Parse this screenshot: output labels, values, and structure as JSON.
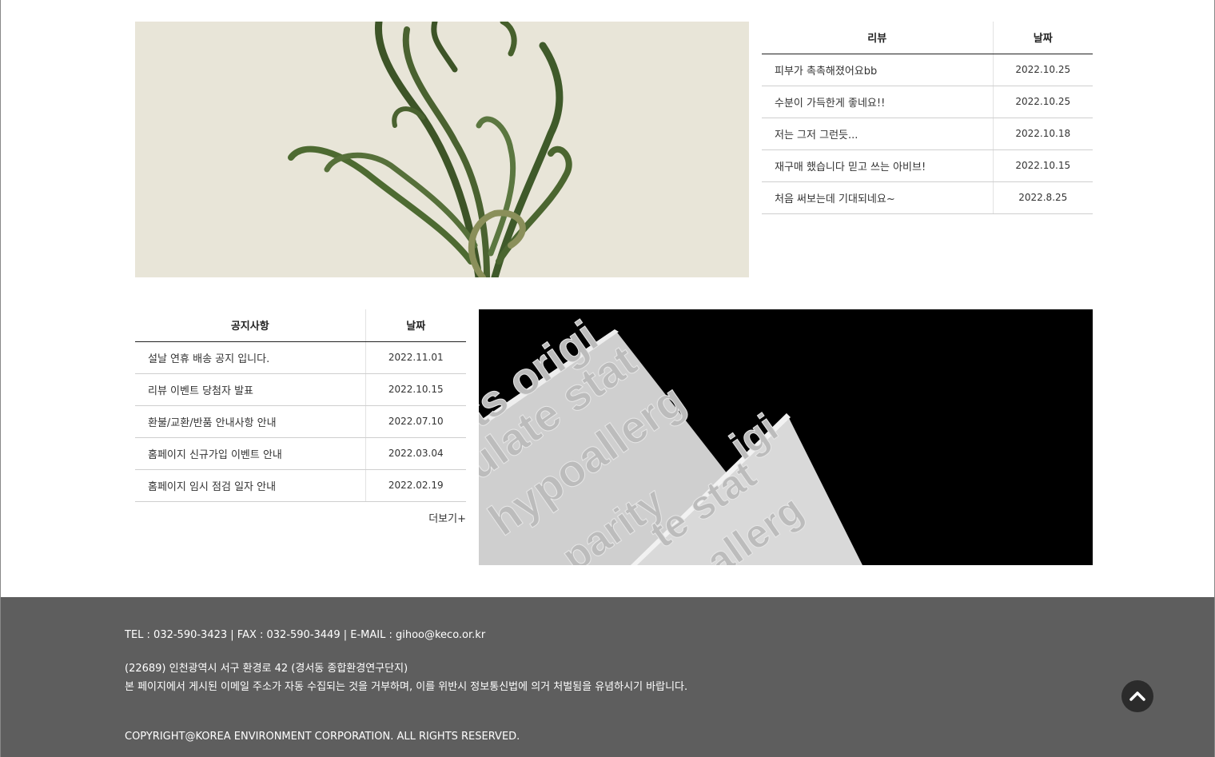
{
  "review_board": {
    "header_title": "리뷰",
    "header_date": "날짜",
    "rows": [
      {
        "title": "피부가 촉촉해졌어요bb",
        "date": "2022.10.25"
      },
      {
        "title": "수분이 가득한게 좋네요!!",
        "date": "2022.10.25"
      },
      {
        "title": "저는 그저 그런듯...",
        "date": "2022.10.18"
      },
      {
        "title": "재구매 했습니다 믿고 쓰는 아비브!",
        "date": "2022.10.15"
      },
      {
        "title": "처음 써보는데 기대되네요~",
        "date": "2022.8.25"
      }
    ]
  },
  "notice_board": {
    "header_title": "공지사항",
    "header_date": "날짜",
    "rows": [
      {
        "title": "설날 연휴 배송 공지 입니다.",
        "date": "2022.11.01"
      },
      {
        "title": "리뷰 이벤트 당첨자 발표",
        "date": "2022.10.15"
      },
      {
        "title": "환불/교환/반품 안내사항 안내",
        "date": "2022.07.10"
      },
      {
        "title": "홈페이지 신규가입 이벤트 안내",
        "date": "2022.03.04"
      },
      {
        "title": "홈페이지 임시 점검 일자 안내",
        "date": "2022.02.19"
      }
    ],
    "more_label": "더보기+"
  },
  "paper_image": {
    "embossed_words": [
      "ts origi",
      "ulate stat",
      "hypoallerg",
      "parity",
      "igi",
      "te stat",
      "allerg"
    ]
  },
  "footer": {
    "contact": "TEL : 032-590-3423 | FAX : 032-590-3449 | E-MAIL : gihoo@keco.or.kr",
    "address": "(22689) 인천광역시 서구 환경로 42 (경서동 종합환경연구단지)",
    "email_notice": "본 페이지에서 게시된 이메일 주소가 자동 수집되는 것을 거부하며, 이를 위반시 정보통신법에 의거 처벌됨을 유념하시기 바랍니다.",
    "copyright": "COPYRIGHT@KOREA ENVIRONMENT CORPORATION. ALL RIGHTS RESERVED.",
    "top_button_icon": "chevron-up-icon"
  },
  "colors": {
    "footer_bg": "#5e5e5e",
    "plant_bg": "#e8e5d8",
    "top_button_bg": "#2b2b2b"
  }
}
